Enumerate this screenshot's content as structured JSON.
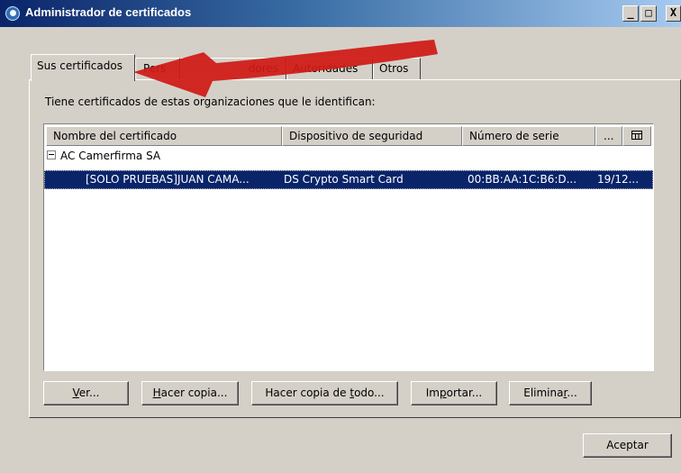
{
  "window": {
    "title": "Administrador de certificados",
    "minimize_label": "_",
    "maximize_label": "□",
    "close_label": "X"
  },
  "tabs": [
    {
      "label": "Sus certificados"
    },
    {
      "label": "Pers"
    },
    {
      "label": "dores"
    },
    {
      "label": "Autoridades"
    },
    {
      "label": "Otros"
    }
  ],
  "description": "Tiene certificados de estas organizaciones que le identifican:",
  "table": {
    "columns": [
      "Nombre del certificado",
      "Dispositivo de seguridad",
      "Número de serie",
      "..."
    ],
    "column_picker_icon": "column-picker-icon",
    "organization": "AC Camerfirma SA",
    "selected_row": {
      "name": "[SOLO PRUEBAS]JUAN CAMA...",
      "device": "DS Crypto Smart Card",
      "serial": "00:BB:AA:1C:B6:D...",
      "date": "19/12..."
    }
  },
  "buttons": {
    "view": {
      "pre": "",
      "key": "V",
      "post": "er..."
    },
    "backup": {
      "pre": "",
      "key": "H",
      "post": "acer copia..."
    },
    "backup_all": {
      "pre": "Hacer copia de ",
      "key": "t",
      "post": "odo..."
    },
    "import": {
      "pre": "Im",
      "key": "p",
      "post": "ortar..."
    },
    "delete": {
      "pre": "Elimina",
      "key": "r",
      "post": "..."
    },
    "accept": "Aceptar"
  },
  "annotation": {
    "color": "#d01a16"
  }
}
